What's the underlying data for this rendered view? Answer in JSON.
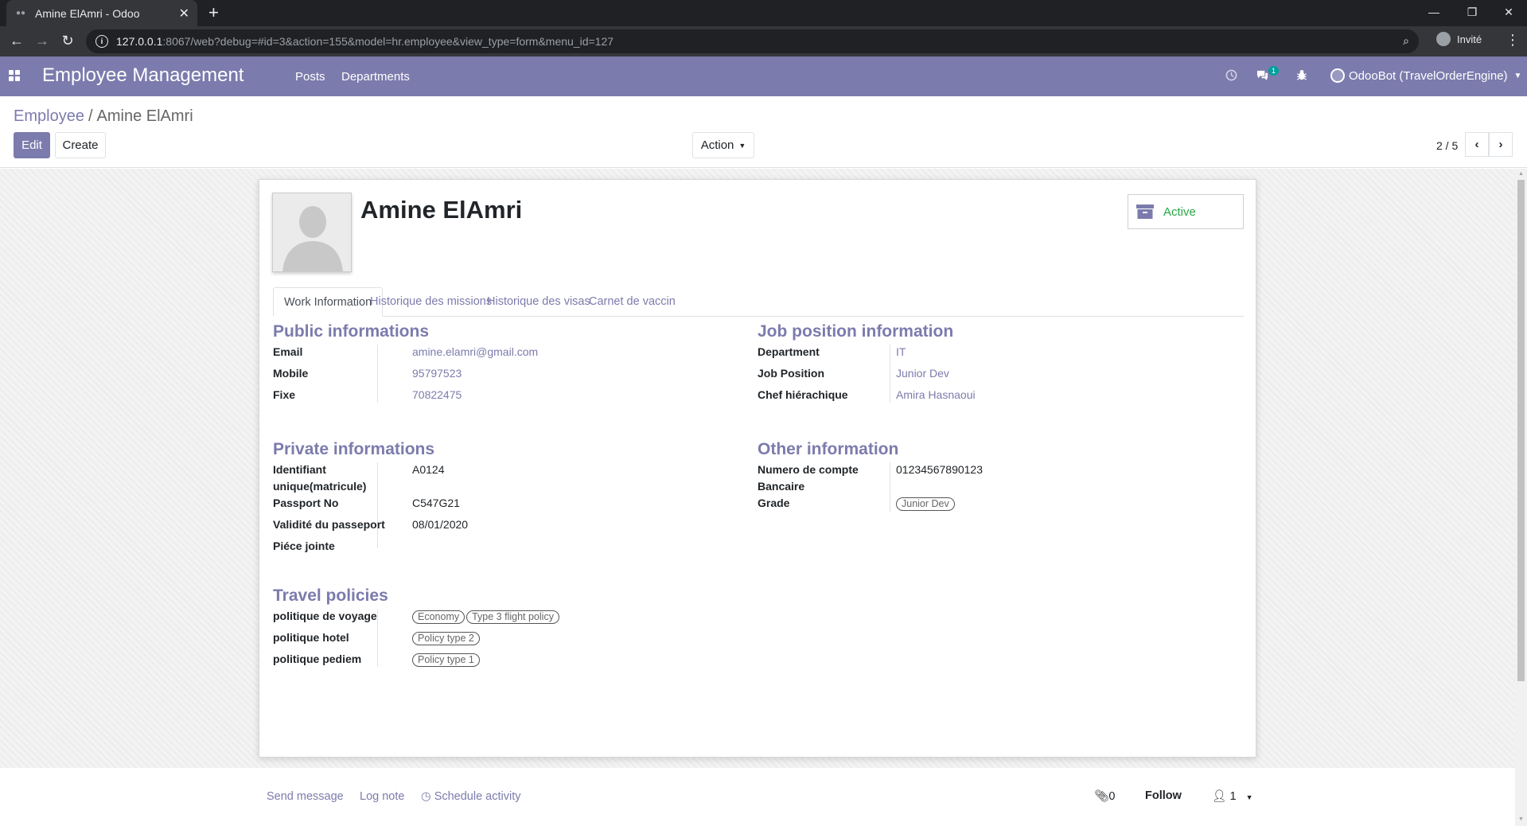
{
  "browser": {
    "tab_title": "Amine ElAmri - Odoo",
    "url_host": "127.0.0.1",
    "url_path": ":8067/web?debug=#id=3&action=155&model=hr.employee&view_type=form&menu_id=127",
    "profile_label": "Invité"
  },
  "navbar": {
    "brand": "Employee Management",
    "menu": [
      "Posts",
      "Departments"
    ],
    "messages_count": "1",
    "user": "OdooBot (TravelOrderEngine)",
    "accent_color": "#7c7bad"
  },
  "control_panel": {
    "breadcrumb_parent": "Employee",
    "breadcrumb_separator": "/",
    "breadcrumb_current": "Amine ElAmri",
    "edit_label": "Edit",
    "create_label": "Create",
    "action_label": "Action",
    "pager": "2 / 5"
  },
  "record": {
    "name": "Amine ElAmri",
    "status_label": "Active",
    "tabs": [
      "Work Information",
      "Historique des missions",
      "Historique des visas",
      "Carnet de vaccin"
    ],
    "public": {
      "title": "Public informations",
      "fields": [
        {
          "label": "Email",
          "value": "amine.elamri@gmail.com"
        },
        {
          "label": "Mobile",
          "value": "95797523"
        },
        {
          "label": "Fixe",
          "value": "70822475"
        }
      ]
    },
    "job": {
      "title": "Job position information",
      "fields": [
        {
          "label": "Department",
          "value": "IT"
        },
        {
          "label": "Job Position",
          "value": "Junior Dev"
        },
        {
          "label": "Chef hiérachique",
          "value": "Amira Hasnaoui"
        }
      ]
    },
    "private": {
      "title": "Private informations",
      "fields": [
        {
          "label": "Identifiant unique(matricule)",
          "value": "A0124"
        },
        {
          "label": "Passport No",
          "value": "C547G21"
        },
        {
          "label": "Validité du passeport",
          "value": "08/01/2020"
        },
        {
          "label": "Piéce jointe",
          "value": ""
        }
      ]
    },
    "other": {
      "title": "Other information",
      "fields": [
        {
          "label": "Numero de compte Bancaire",
          "value": "01234567890123"
        },
        {
          "label": "Grade",
          "tag": "Junior Dev"
        }
      ]
    },
    "travel": {
      "title": "Travel policies",
      "fields": [
        {
          "label": "politique de voyage",
          "tags": [
            "Economy",
            "Type 3 flight policy"
          ]
        },
        {
          "label": "politique hotel",
          "tags": [
            "Policy type 2"
          ]
        },
        {
          "label": "politique pediem",
          "tags": [
            "Policy type 1"
          ]
        }
      ]
    }
  },
  "chatter": {
    "send_message": "Send message",
    "log_note": "Log note",
    "schedule_activity": "Schedule activity",
    "attachments_count": "0",
    "follow": "Follow",
    "followers_count": "1"
  }
}
